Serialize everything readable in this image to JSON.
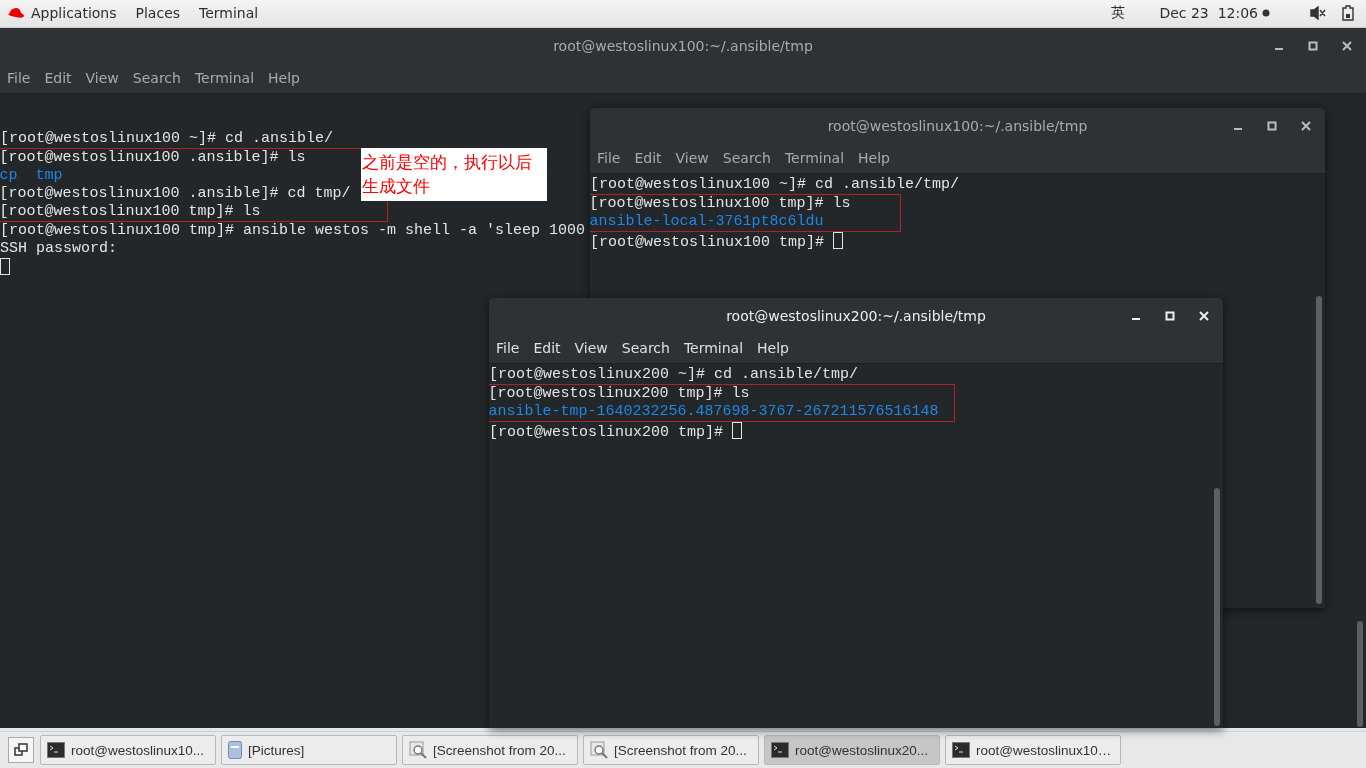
{
  "top_bar": {
    "menus": [
      "Applications",
      "Places",
      "Terminal"
    ],
    "input_method": "英",
    "clock": "Dec 23  12:06"
  },
  "windows": [
    {
      "title": "root@westoslinux100:~/.ansible/tmp",
      "focused": false,
      "menu": [
        "File",
        "Edit",
        "View",
        "Search",
        "Terminal",
        "Help"
      ],
      "note": "之前是空的，执行以后生成文件",
      "lines": [
        {
          "text": "[root@westoslinux100 ~]# cd .ansible/",
          "kind": "prompt",
          "boxed": false
        },
        {
          "text": "[root@westoslinux100 .ansible]# ls",
          "kind": "prompt",
          "boxed": true
        },
        {
          "text": "cp  tmp",
          "kind": "output",
          "boxed": true
        },
        {
          "text": "[root@westoslinux100 .ansible]# cd tmp/",
          "kind": "prompt",
          "boxed": true
        },
        {
          "text": "[root@westoslinux100 tmp]# ls",
          "kind": "prompt",
          "boxed": true
        },
        {
          "text": "[root@westoslinux100 tmp]# ansible westos -m shell -a 'sleep 1000",
          "kind": "prompt",
          "boxed": false
        },
        {
          "text": "SSH password:",
          "kind": "prompt",
          "boxed": false,
          "cursor": true,
          "cursor_wrapped": true
        }
      ]
    },
    {
      "title": "root@westoslinux100:~/.ansible/tmp",
      "focused": false,
      "menu": [
        "File",
        "Edit",
        "View",
        "Search",
        "Terminal",
        "Help"
      ],
      "lines": [
        {
          "text": "[root@westoslinux100 ~]# cd .ansible/tmp/",
          "kind": "prompt",
          "boxed": false
        },
        {
          "text": "[root@westoslinux100 tmp]# ls",
          "kind": "prompt",
          "boxed": true
        },
        {
          "text": "ansible-local-3761pt8c6ldu",
          "kind": "output",
          "boxed": true
        },
        {
          "text": "[root@westoslinux100 tmp]#",
          "kind": "prompt",
          "boxed": false,
          "cursor": true,
          "cursor_wrapped": false
        }
      ]
    },
    {
      "title": "root@westoslinux200:~/.ansible/tmp",
      "focused": true,
      "menu": [
        "File",
        "Edit",
        "View",
        "Search",
        "Terminal",
        "Help"
      ],
      "lines": [
        {
          "text": "[root@westoslinux200 ~]# cd .ansible/tmp/",
          "kind": "prompt",
          "boxed": false
        },
        {
          "text": "[root@westoslinux200 tmp]# ls",
          "kind": "prompt",
          "boxed": true
        },
        {
          "text": "ansible-tmp-1640232256.487698-3767-267211576516148",
          "kind": "output",
          "boxed": true
        },
        {
          "text": "[root@westoslinux200 tmp]#",
          "kind": "prompt",
          "boxed": false,
          "cursor": true,
          "cursor_wrapped": false
        }
      ]
    }
  ],
  "taskbar": [
    {
      "label": "root@westoslinux10...",
      "kind": "terminal",
      "selected": false
    },
    {
      "label": "[Pictures]",
      "kind": "folder",
      "selected": false
    },
    {
      "label": "[Screenshot from 20...",
      "kind": "screenshot",
      "selected": false
    },
    {
      "label": "[Screenshot from 20...",
      "kind": "screenshot",
      "selected": false
    },
    {
      "label": "root@westoslinux20...",
      "kind": "terminal",
      "selected": true
    },
    {
      "label": "root@westoslinux10…",
      "kind": "terminal",
      "selected": false
    }
  ]
}
